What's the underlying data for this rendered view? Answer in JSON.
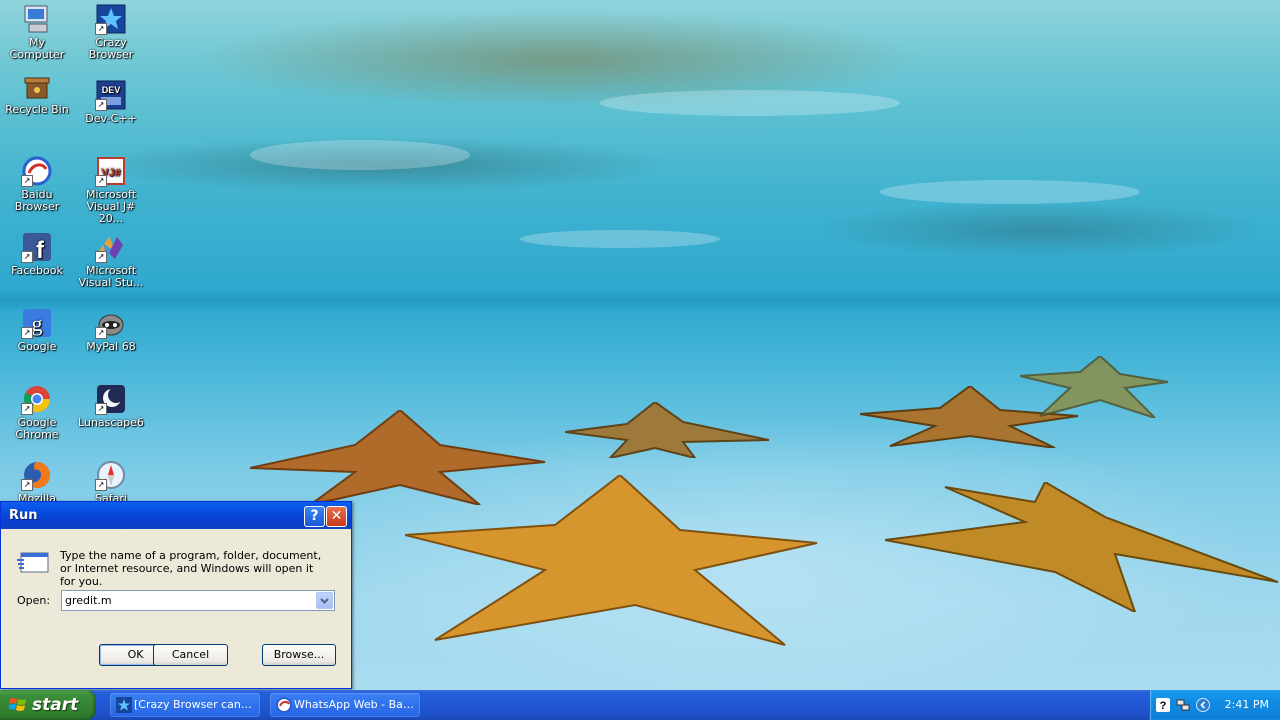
{
  "desktop": {
    "icons": [
      {
        "label": "My Computer"
      },
      {
        "label": "Crazy Browser"
      },
      {
        "label": "Recycle Bin"
      },
      {
        "label": "Dev-C++"
      },
      {
        "label": "Baidu Browser"
      },
      {
        "label": "Microsoft Visual J# 20..."
      },
      {
        "label": "Facebook"
      },
      {
        "label": "Microsoft Visual Stu..."
      },
      {
        "label": "Google"
      },
      {
        "label": "MyPal 68"
      },
      {
        "label": "Google Chrome"
      },
      {
        "label": "Lunascape6"
      },
      {
        "label": "Mozilla Firefox"
      },
      {
        "label": "Safari"
      }
    ]
  },
  "run_dialog": {
    "title": "Run",
    "help_label": "?",
    "close_label": "✕",
    "description": "Type the name of a program, folder, document, or Internet resource, and Windows will open it for you.",
    "open_label": "Open:",
    "open_value": "gredit.m",
    "ok_label": "OK",
    "cancel_label": "Cancel",
    "browse_label": "Browse..."
  },
  "taskbar": {
    "start_label": "start",
    "tasks": [
      {
        "label": "[Crazy Browser cann...",
        "icon": "crazy-browser-icon"
      },
      {
        "label": "WhatsApp Web - Bai...",
        "icon": "baidu-browser-icon"
      }
    ],
    "clock": "2:41 PM"
  },
  "colors": {
    "taskbar_blue": "#245edb",
    "start_green": "#3c8d3a",
    "tray_blue": "#118be3",
    "dialog_face": "#ece9d8",
    "title_blue": "#0848dd"
  }
}
